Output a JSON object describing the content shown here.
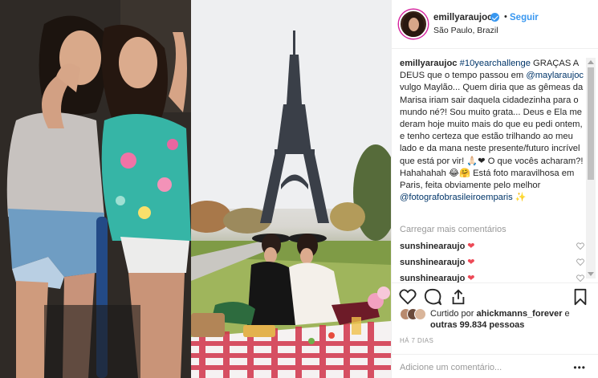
{
  "header": {
    "username": "emillyaraujoc",
    "follow_label": "Seguir",
    "location": "São Paulo, Brazil",
    "dot": "•"
  },
  "caption": {
    "username": "emillyaraujoc",
    "hashtag": "#10yearchallenge",
    "text1": " GRAÇAS A DEUS que o tempo passou em ",
    "mention1": "@maylaraujoc",
    "text2": " vulgo Maylão... Quem diria que as gêmeas da Marisa iriam sair daquela cidadezinha para o mundo né?! Sou muito grata... Deus e Ela me deram hoje muito mais do que eu pedi ontem, e tenho certeza que estão trilhando ao meu lado e da mana neste presente/futuro incrível que está por vir! 🙏🏻❤ O que vocês acharam?! Hahahahah 😂🤗 Está foto maravilhosa em Paris, feita obviamente pelo melhor ",
    "mention2": "@fotografobrasileiroemparis",
    "emoji_end": " ✨"
  },
  "load_more": "Carregar mais comentários",
  "comments": [
    {
      "user": "sunshinearaujo",
      "emoji": "❤"
    },
    {
      "user": "sunshinearaujo",
      "emoji": "❤"
    },
    {
      "user": "sunshinearaujo",
      "emoji": "❤"
    }
  ],
  "actions": {
    "like_icon": "heart-outline-icon",
    "comment_icon": "speech-bubble-icon",
    "share_icon": "share-icon",
    "save_icon": "bookmark-icon"
  },
  "likes": {
    "prefix": "Curtido por ",
    "liker": "ahickmanns_forever",
    "middle": " e ",
    "others": "outras 99.834 pessoas"
  },
  "timestamp": "HÁ 7 DIAS",
  "add_comment_placeholder": "Adicione um comentário...",
  "more_options": "•••",
  "colors": {
    "link": "#003569",
    "follow": "#3897f0",
    "heart": "#ed4956",
    "muted": "#999999"
  }
}
